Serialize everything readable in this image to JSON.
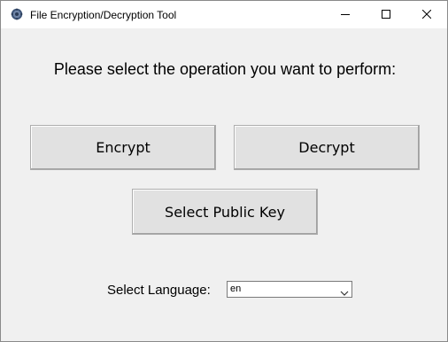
{
  "window": {
    "title": "File Encryption/Decryption Tool",
    "app_icon": "gear-icon",
    "controls": [
      "minimize-icon",
      "maximize-icon",
      "close-icon"
    ]
  },
  "main": {
    "heading": "Please select the operation you want to perform:",
    "encrypt_label": "Encrypt",
    "decrypt_label": "Decrypt",
    "public_key_label": "Select Public Key"
  },
  "language": {
    "label": "Select Language:",
    "selected": "en"
  },
  "colors": {
    "background": "#f0f0f0",
    "button_face": "#e1e1e1",
    "titlebar": "#ffffff"
  }
}
